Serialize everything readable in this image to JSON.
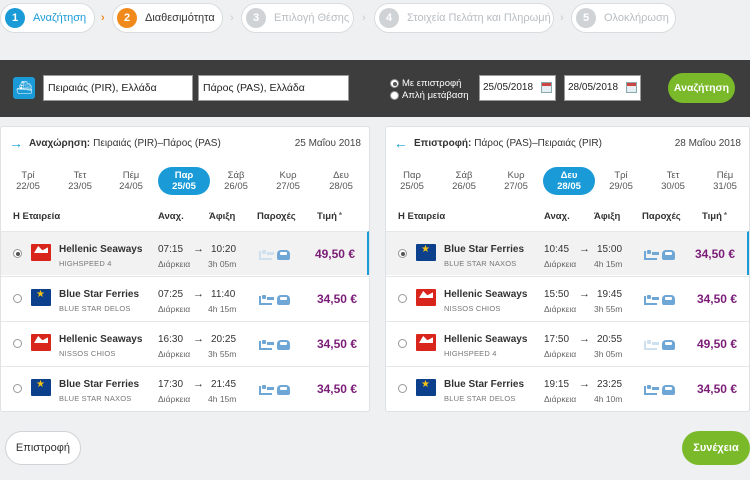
{
  "steps": [
    {
      "num": "1",
      "label": "Αναζήτηση"
    },
    {
      "num": "2",
      "label": "Διαθεσιμότητα"
    },
    {
      "num": "3",
      "label": "Επιλογή Θέσης"
    },
    {
      "num": "4",
      "label": "Στοιχεία Πελάτη και Πληρωμή"
    },
    {
      "num": "5",
      "label": "Ολοκλήρωση"
    }
  ],
  "search": {
    "from": "Πειραιάς (PIR), Ελλάδα",
    "to": "Πάρος (PAS), Ελλάδα",
    "opt_return": "Με επιστροφή",
    "opt_oneway": "Απλή μετάβαση",
    "date_out": "25/05/2018",
    "date_back": "28/05/2018",
    "button": "Αναζήτηση"
  },
  "outbound": {
    "title_bold": "Αναχώρηση:",
    "route": "Πειραιάς (PIR)–Πάρος (PAS)",
    "date": "25 Μαΐου 2018",
    "days": [
      {
        "d": "Τρί",
        "n": "22/05"
      },
      {
        "d": "Τετ",
        "n": "23/05"
      },
      {
        "d": "Πέμ",
        "n": "24/05"
      },
      {
        "d": "Παρ",
        "n": "25/05"
      },
      {
        "d": "Σάβ",
        "n": "26/05"
      },
      {
        "d": "Κυρ",
        "n": "27/05"
      },
      {
        "d": "Δευ",
        "n": "28/05"
      }
    ],
    "rows": [
      {
        "company": "Hellenic Seaways",
        "vessel": "HIGHSPEED 4",
        "dep": "07:15",
        "arr": "10:20",
        "dur": "3h 05m",
        "price": "49,50 €"
      },
      {
        "company": "Blue Star Ferries",
        "vessel": "BLUE STAR DELOS",
        "dep": "07:25",
        "arr": "11:40",
        "dur": "4h 15m",
        "price": "34,50 €"
      },
      {
        "company": "Hellenic Seaways",
        "vessel": "NISSOS CHIOS",
        "dep": "16:30",
        "arr": "20:25",
        "dur": "3h 55m",
        "price": "34,50 €"
      },
      {
        "company": "Blue Star Ferries",
        "vessel": "BLUE STAR NAXOS",
        "dep": "17:30",
        "arr": "21:45",
        "dur": "4h 15m",
        "price": "34,50 €"
      }
    ]
  },
  "inbound": {
    "title_bold": "Επιστροφή:",
    "route": "Πάρος (PAS)–Πειραιάς (PIR)",
    "date": "28 Μαΐου 2018",
    "days": [
      {
        "d": "Παρ",
        "n": "25/05"
      },
      {
        "d": "Σάβ",
        "n": "26/05"
      },
      {
        "d": "Κυρ",
        "n": "27/05"
      },
      {
        "d": "Δευ",
        "n": "28/05"
      },
      {
        "d": "Τρί",
        "n": "29/05"
      },
      {
        "d": "Τετ",
        "n": "30/05"
      },
      {
        "d": "Πέμ",
        "n": "31/05"
      }
    ],
    "rows": [
      {
        "company": "Blue Star Ferries",
        "vessel": "BLUE STAR NAXOS",
        "dep": "10:45",
        "arr": "15:00",
        "dur": "4h 15m",
        "price": "34,50 €"
      },
      {
        "company": "Hellenic Seaways",
        "vessel": "NISSOS CHIOS",
        "dep": "15:50",
        "arr": "19:45",
        "dur": "3h 55m",
        "price": "34,50 €"
      },
      {
        "company": "Hellenic Seaways",
        "vessel": "HIGHSPEED 4",
        "dep": "17:50",
        "arr": "20:55",
        "dur": "3h 05m",
        "price": "49,50 €"
      },
      {
        "company": "Blue Star Ferries",
        "vessel": "BLUE STAR DELOS",
        "dep": "19:15",
        "arr": "23:25",
        "dur": "4h 10m",
        "price": "34,50 €"
      }
    ]
  },
  "headers": {
    "company": "Η Εταιρεία",
    "dep": "Αναχ.",
    "arr": "Άφιξη",
    "fac": "Παροχές",
    "price": "Τιμή",
    "star": "*",
    "duration": "Διάρκεια",
    "arrow": "→"
  },
  "footer": {
    "back": "Επιστροφή",
    "next": "Συνέχεια"
  },
  "colors": {
    "accent": "#1a9bd7",
    "active_step": "#f08a1c",
    "green": "#7ab929",
    "price": "#7b1d78"
  }
}
